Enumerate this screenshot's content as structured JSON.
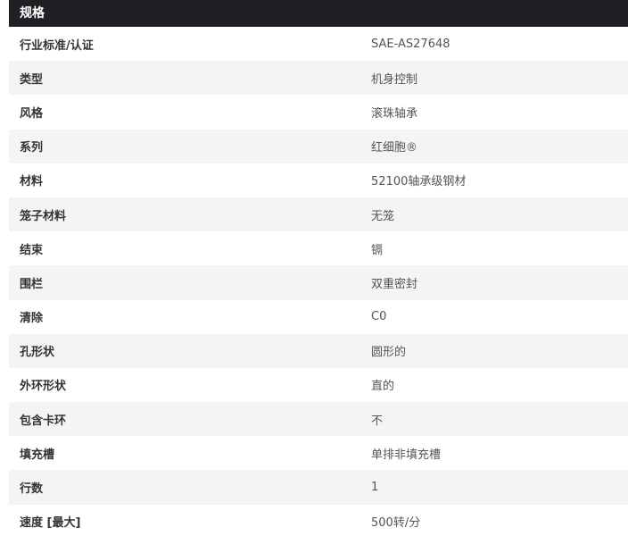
{
  "header": {
    "title": "规格"
  },
  "specs": [
    {
      "label": "行业标准/认证",
      "value": "SAE-AS27648"
    },
    {
      "label": "类型",
      "value": "机身控制"
    },
    {
      "label": "风格",
      "value": "滚珠轴承"
    },
    {
      "label": "系列",
      "value": "红细胞®"
    },
    {
      "label": "材料",
      "value": "52100轴承级钢材"
    },
    {
      "label": "笼子材料",
      "value": "无笼"
    },
    {
      "label": "结束",
      "value": "镉"
    },
    {
      "label": "围栏",
      "value": "双重密封"
    },
    {
      "label": "清除",
      "value": "C0"
    },
    {
      "label": "孔形状",
      "value": "圆形的"
    },
    {
      "label": "外环形状",
      "value": "直的"
    },
    {
      "label": "包含卡环",
      "value": "不"
    },
    {
      "label": "填充槽",
      "value": "单排非填充槽"
    },
    {
      "label": "行数",
      "value": "1"
    },
    {
      "label": "速度 [最大]",
      "value": "500转/分"
    }
  ],
  "colors": {
    "header_bg": "#1e2023",
    "header_text": "#ffffff",
    "row_alt_bg": "#f4f4f4",
    "label_text": "#333333",
    "value_text": "#555555"
  }
}
